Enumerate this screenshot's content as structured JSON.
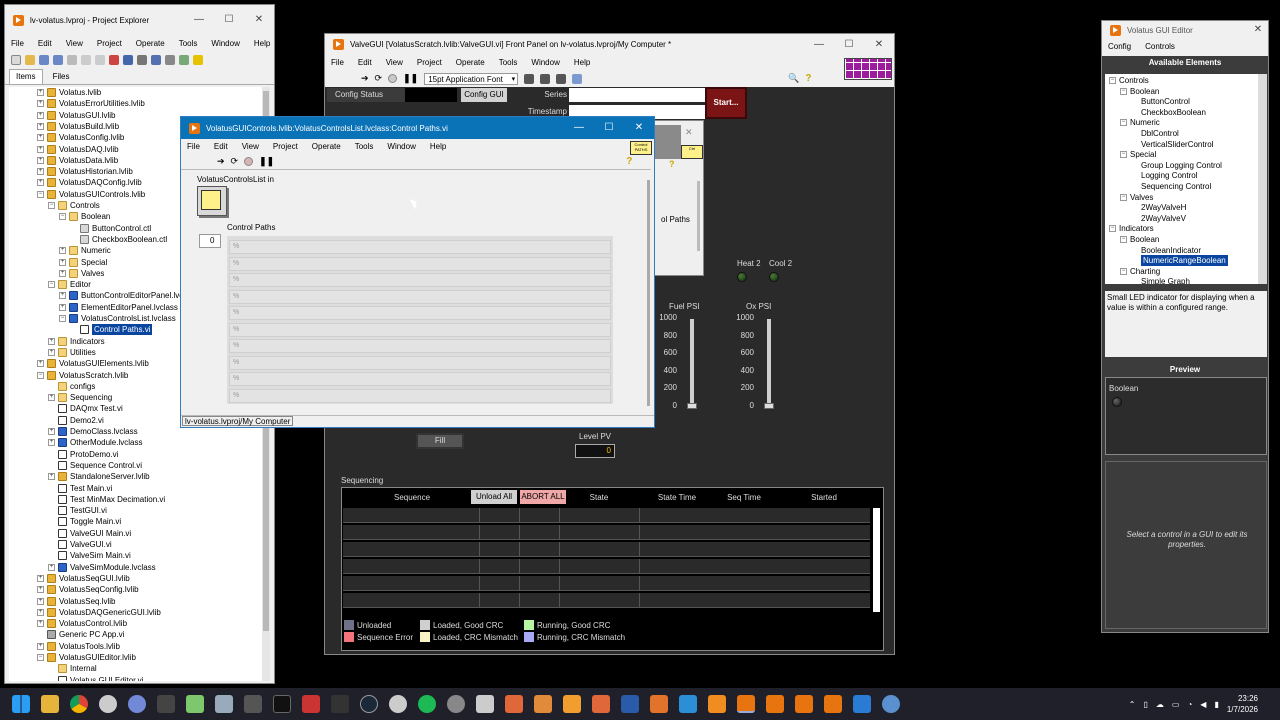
{
  "project_explorer": {
    "title": "lv-volatus.lvproj - Project Explorer",
    "menu": [
      "File",
      "Edit",
      "View",
      "Project",
      "Operate",
      "Tools",
      "Window",
      "Help"
    ],
    "tabs": [
      "Items",
      "Files"
    ],
    "tree": [
      {
        "label": "Volatus.lvlib",
        "indent": 0,
        "icon": "lib",
        "exp": "+"
      },
      {
        "label": "VolatusErrorUtilities.lvlib",
        "indent": 0,
        "icon": "lib",
        "exp": "+"
      },
      {
        "label": "VolatusGUI.lvlib",
        "indent": 0,
        "icon": "lib",
        "exp": "+"
      },
      {
        "label": "VolatusBuild.lvlib",
        "indent": 0,
        "icon": "lib",
        "exp": "+"
      },
      {
        "label": "VolatusConfig.lvlib",
        "indent": 0,
        "icon": "lib",
        "exp": "+"
      },
      {
        "label": "VolatusDAQ.lvlib",
        "indent": 0,
        "icon": "lib",
        "exp": "+"
      },
      {
        "label": "VolatusData.lvlib",
        "indent": 0,
        "icon": "lib",
        "exp": "+"
      },
      {
        "label": "VolatusHistorian.lvlib",
        "indent": 0,
        "icon": "lib",
        "exp": "+"
      },
      {
        "label": "VolatusDAQConfig.lvlib",
        "indent": 0,
        "icon": "lib",
        "exp": "+"
      },
      {
        "label": "VolatusGUIControls.lvlib",
        "indent": 0,
        "icon": "lib",
        "exp": "−"
      },
      {
        "label": "Controls",
        "indent": 1,
        "icon": "fld",
        "exp": "−"
      },
      {
        "label": "Boolean",
        "indent": 2,
        "icon": "fld",
        "exp": "−"
      },
      {
        "label": "ButtonControl.ctl",
        "indent": 3,
        "icon": "ctl",
        "exp": ""
      },
      {
        "label": "CheckboxBoolean.ctl",
        "indent": 3,
        "icon": "ctl",
        "exp": ""
      },
      {
        "label": "Numeric",
        "indent": 2,
        "icon": "fld",
        "exp": "+"
      },
      {
        "label": "Special",
        "indent": 2,
        "icon": "fld",
        "exp": "+"
      },
      {
        "label": "Valves",
        "indent": 2,
        "icon": "fld",
        "exp": "+"
      },
      {
        "label": "Editor",
        "indent": 1,
        "icon": "fld",
        "exp": "−"
      },
      {
        "label": "ButtonControlEditorPanel.lvclass",
        "indent": 2,
        "icon": "cls",
        "exp": "+"
      },
      {
        "label": "ElementEditorPanel.lvclass",
        "indent": 2,
        "icon": "cls",
        "exp": "+"
      },
      {
        "label": "VolatusControlsList.lvclass",
        "indent": 2,
        "icon": "cls",
        "exp": "−"
      },
      {
        "label": "Control Paths.vi",
        "indent": 3,
        "icon": "vi",
        "exp": "",
        "sel": true
      },
      {
        "label": "Indicators",
        "indent": 1,
        "icon": "fld",
        "exp": "+"
      },
      {
        "label": "Utilities",
        "indent": 1,
        "icon": "fld",
        "exp": "+"
      },
      {
        "label": "VolatusGUIElements.lvlib",
        "indent": 0,
        "icon": "lib",
        "exp": "+"
      },
      {
        "label": "VolatusScratch.lvlib",
        "indent": 0,
        "icon": "lib",
        "exp": "−"
      },
      {
        "label": "configs",
        "indent": 1,
        "icon": "fld",
        "exp": ""
      },
      {
        "label": "Sequencing",
        "indent": 1,
        "icon": "fld",
        "exp": "+"
      },
      {
        "label": "DAQmx Test.vi",
        "indent": 1,
        "icon": "vi",
        "exp": ""
      },
      {
        "label": "Demo2.vi",
        "indent": 1,
        "icon": "vi",
        "exp": ""
      },
      {
        "label": "DemoClass.lvclass",
        "indent": 1,
        "icon": "cls",
        "exp": "+"
      },
      {
        "label": "OtherModule.lvclass",
        "indent": 1,
        "icon": "cls",
        "exp": "+"
      },
      {
        "label": "ProtoDemo.vi",
        "indent": 1,
        "icon": "vi",
        "exp": ""
      },
      {
        "label": "Sequence Control.vi",
        "indent": 1,
        "icon": "vi",
        "exp": ""
      },
      {
        "label": "StandaloneServer.lvlib",
        "indent": 1,
        "icon": "lib",
        "exp": "+"
      },
      {
        "label": "Test Main.vi",
        "indent": 1,
        "icon": "vi",
        "exp": ""
      },
      {
        "label": "Test MinMax Decimation.vi",
        "indent": 1,
        "icon": "vi",
        "exp": ""
      },
      {
        "label": "TestGUI.vi",
        "indent": 1,
        "icon": "vi",
        "exp": ""
      },
      {
        "label": "Toggle Main.vi",
        "indent": 1,
        "icon": "vi",
        "exp": ""
      },
      {
        "label": "ValveGUI Main.vi",
        "indent": 1,
        "icon": "vi",
        "exp": ""
      },
      {
        "label": "ValveGUI.vi",
        "indent": 1,
        "icon": "vi",
        "exp": ""
      },
      {
        "label": "ValveSim Main.vi",
        "indent": 1,
        "icon": "vi",
        "exp": ""
      },
      {
        "label": "ValveSimModule.lvclass",
        "indent": 1,
        "icon": "cls",
        "exp": "+"
      },
      {
        "label": "VolatusSeqGUI.lvlib",
        "indent": 0,
        "icon": "lib",
        "exp": "+"
      },
      {
        "label": "VolatusSeqConfig.lvlib",
        "indent": 0,
        "icon": "lib",
        "exp": "+"
      },
      {
        "label": "VolatusSeq.lvlib",
        "indent": 0,
        "icon": "lib",
        "exp": "+"
      },
      {
        "label": "VolatusDAQGenericGUI.lvlib",
        "indent": 0,
        "icon": "lib",
        "exp": "+"
      },
      {
        "label": "VolatusControl.lvlib",
        "indent": 0,
        "icon": "lib",
        "exp": "+"
      },
      {
        "label": "Generic PC App.vi",
        "indent": 0,
        "icon": "app",
        "exp": ""
      },
      {
        "label": "VolatusTools.lvlib",
        "indent": 0,
        "icon": "lib",
        "exp": "+"
      },
      {
        "label": "VolatusGUIEditor.lvlib",
        "indent": 0,
        "icon": "lib",
        "exp": "−"
      },
      {
        "label": "Internal",
        "indent": 1,
        "icon": "fld",
        "exp": ""
      },
      {
        "label": "Volatus GUI Editor.vi",
        "indent": 1,
        "icon": "vi",
        "exp": ""
      }
    ]
  },
  "valvegui": {
    "title": "ValveGUI [VolatusScratch.lvlib:ValveGUI.vi] Front Panel on lv-volatus.lvproj/My Computer *",
    "menu": [
      "File",
      "Edit",
      "View",
      "Project",
      "Operate",
      "Tools",
      "Window",
      "Help"
    ],
    "font_selector": "15pt Application Font",
    "config_status": "Config Status",
    "config_gui": "Config GUI",
    "series": "Series",
    "timestamp": "Timestamp",
    "start": "Start...",
    "heat2": "Heat 2",
    "cool2": "Cool 2",
    "fuel_psi": "Fuel PSI",
    "ox_psi": "Ox PSI",
    "scale": [
      "1000",
      "800",
      "600",
      "400",
      "200",
      "0"
    ],
    "slider_value": "0",
    "fill": "Fill",
    "level_pv": "Level PV",
    "level_value": "0",
    "sequencing": "Sequencing",
    "seq_cols": [
      "Sequence",
      "Unload All",
      "ABORT ALL",
      "State",
      "State Time",
      "Seq Time",
      "Started"
    ],
    "legend": [
      {
        "label": "Unloaded",
        "color": "#6e7187"
      },
      {
        "label": "Loaded, Good CRC",
        "color": "#cfcfcf"
      },
      {
        "label": "Running, Good CRC",
        "color": "#b7f5a4"
      },
      {
        "label": "Sequence Error",
        "color": "#f2747a"
      },
      {
        "label": "Loaded, CRC Mismatch",
        "color": "#f7f3c4"
      },
      {
        "label": "Running, CRC Mismatch",
        "color": "#a9a9f5"
      }
    ],
    "partial_label": "ol Paths"
  },
  "control_paths": {
    "title": "VolatusGUIControls.lvlib:VolatusControlsList.lvclass:Control Paths.vi",
    "menu": [
      "File",
      "Edit",
      "View",
      "Project",
      "Operate",
      "Tools",
      "Window",
      "Help"
    ],
    "in_label": "VolatusControlsList in",
    "paths_label": "Control Paths",
    "index": "0",
    "row_glyph": "%",
    "rows": 10,
    "status": "lv-volatus.lvproj/My Computer",
    "icon_text": "Control\nPATHS"
  },
  "gui_editor": {
    "title": "Volatus GUI Editor",
    "menu": [
      "Config",
      "Controls"
    ],
    "available_header": "Available Elements",
    "tree": [
      {
        "label": "Controls",
        "indent": 0,
        "exp": "−"
      },
      {
        "label": "Boolean",
        "indent": 1,
        "exp": "−"
      },
      {
        "label": "ButtonControl",
        "indent": 2,
        "exp": ""
      },
      {
        "label": "CheckboxBoolean",
        "indent": 2,
        "exp": ""
      },
      {
        "label": "Numeric",
        "indent": 1,
        "exp": "−"
      },
      {
        "label": "DblControl",
        "indent": 2,
        "exp": ""
      },
      {
        "label": "VerticalSliderControl",
        "indent": 2,
        "exp": ""
      },
      {
        "label": "Special",
        "indent": 1,
        "exp": "−"
      },
      {
        "label": "Group Logging Control",
        "indent": 2,
        "exp": ""
      },
      {
        "label": "Logging Control",
        "indent": 2,
        "exp": ""
      },
      {
        "label": "Sequencing Control",
        "indent": 2,
        "exp": ""
      },
      {
        "label": "Valves",
        "indent": 1,
        "exp": "−"
      },
      {
        "label": "2WayValveH",
        "indent": 2,
        "exp": ""
      },
      {
        "label": "2WayValveV",
        "indent": 2,
        "exp": ""
      },
      {
        "label": "Indicators",
        "indent": 0,
        "exp": "−"
      },
      {
        "label": "Boolean",
        "indent": 1,
        "exp": "−"
      },
      {
        "label": "BooleanIndicator",
        "indent": 2,
        "exp": ""
      },
      {
        "label": "NumericRangeBoolean",
        "indent": 2,
        "exp": "",
        "sel": true
      },
      {
        "label": "Charting",
        "indent": 1,
        "exp": "−"
      },
      {
        "label": "Simple Graph",
        "indent": 2,
        "exp": ""
      }
    ],
    "description": "Small LED indicator for displaying when a value is within a configured range.",
    "preview_header": "Preview",
    "preview_label": "Boolean",
    "hint": "Select a control in a GUI to edit its properties."
  },
  "taskbar": {
    "time": "23:26",
    "date": "1/7/2026"
  }
}
